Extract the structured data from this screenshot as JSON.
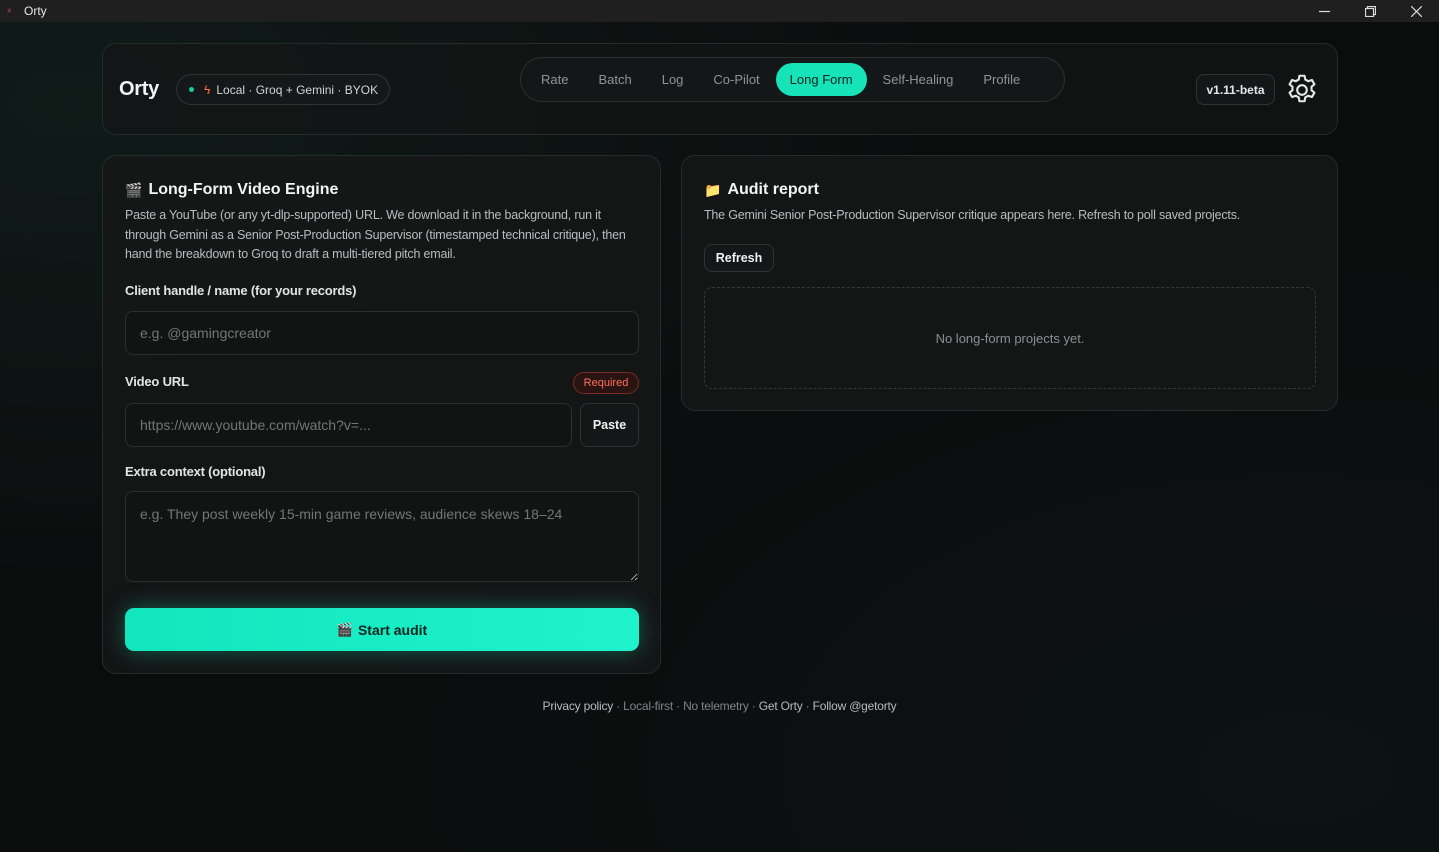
{
  "window": {
    "title": "Orty",
    "controls": [
      "minimize-icon",
      "restore-icon",
      "close-icon"
    ]
  },
  "header": {
    "brand": "Orty",
    "mode_label": "Local · Groq + Gemini · BYOK",
    "tabs": [
      {
        "label": "Rate",
        "active": false
      },
      {
        "label": "Batch",
        "active": false
      },
      {
        "label": "Log",
        "active": false
      },
      {
        "label": "Co-Pilot",
        "active": false
      },
      {
        "label": "Long Form",
        "active": true
      },
      {
        "label": "Self-Healing",
        "active": false
      },
      {
        "label": "Profile",
        "active": false
      }
    ],
    "version": "v1.11-beta",
    "settings_icon": "gear-icon"
  },
  "long_form": {
    "icon": "clapperboard-icon",
    "title": "Long-Form Video Engine",
    "description": "Paste a YouTube (or any yt-dlp-supported) URL. We download it in the background, run it through Gemini as a Senior Post-Production Supervisor (timestamped technical critique), then hand the breakdown to Groq to draft a multi-tiered pitch email.",
    "client_label": "Client handle / name (for your records)",
    "client_placeholder": "e.g. @gamingcreator",
    "client_value": "",
    "url_label": "Video URL",
    "url_badge": "Required",
    "url_placeholder": "https://www.youtube.com/watch?v=...",
    "url_value": "",
    "paste_label": "Paste",
    "context_label": "Extra context (optional)",
    "context_placeholder": "e.g. They post weekly 15-min game reviews, audience skews 18–24",
    "context_value": "",
    "start_label": "Start audit"
  },
  "audit": {
    "icon": "folder-icon",
    "title": "Audit report",
    "description": "The Gemini Senior Post-Production Supervisor critique appears here. Refresh to poll saved projects.",
    "refresh_label": "Refresh",
    "empty_text": "No long-form projects yet."
  },
  "footer": {
    "privacy": "Privacy policy",
    "sep1": " · ",
    "local_first": "Local-first",
    "sep2": " · ",
    "no_telemetry": "No telemetry",
    "sep3": " · ",
    "get_orty": "Get Orty",
    "sep4": " · ",
    "follow": "Follow @getorty"
  },
  "colors": {
    "accent": "#17e3b8",
    "background": "#0b0d0d",
    "required": "#ff6e5a",
    "status_dot": "#18c9a0"
  }
}
